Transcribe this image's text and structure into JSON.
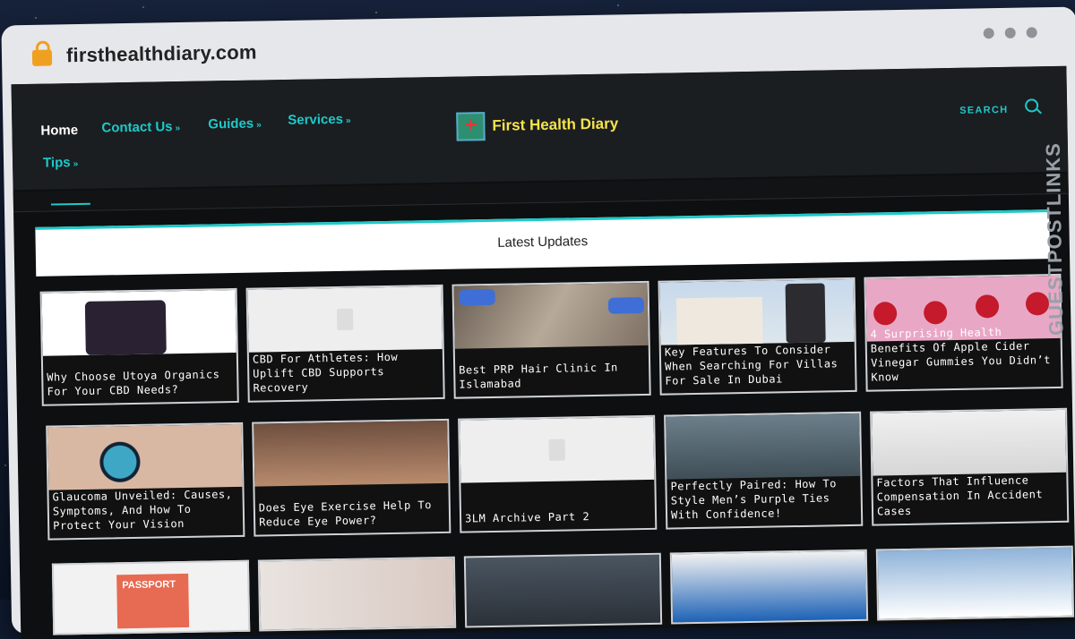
{
  "browser": {
    "url": "firsthealthdiary.com"
  },
  "nav": {
    "home": "Home",
    "contact": "Contact Us",
    "guides": "Guides",
    "services": "Services",
    "tips": "Tips",
    "chevron": "»"
  },
  "brand": {
    "logo_text": "First Health Diary"
  },
  "search": {
    "label": "SEARCH"
  },
  "section": {
    "title": "Latest Updates"
  },
  "watermark": "GUESTPOSTLINKS",
  "cards": [
    "Why Choose Utoya Organics For Your CBD Needs?",
    "CBD For Athletes: How Uplift CBD Supports Recovery",
    "Best PRP Hair Clinic In Islamabad",
    "Key Features To Consider When Searching For Villas For Sale In Dubai",
    "4 Surprising Health Benefits Of Apple Cider Vinegar Gummies You Didn’t Know",
    "Glaucoma Unveiled: Causes, Symptoms, And How To Protect Your Vision",
    "Does Eye Exercise Help To Reduce Eye Power?",
    "3LM Archive Part 2",
    "Perfectly Paired: How To Style Men’s Purple Ties With Confidence!",
    "Factors That Influence Compensation In Accident Cases"
  ],
  "passport_label": "PASSPORT"
}
